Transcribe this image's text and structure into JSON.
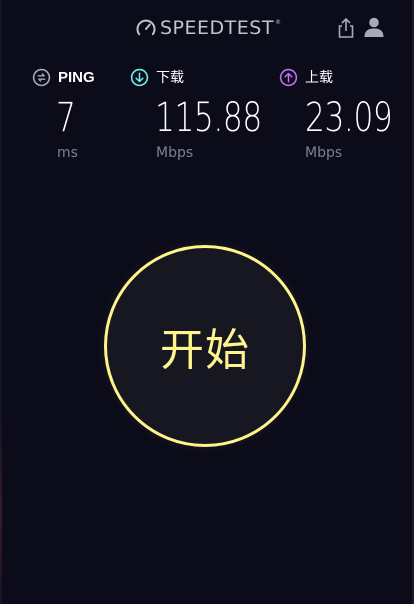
{
  "header": {
    "logo_text": "SPEEDTEST",
    "logo_reg": "®",
    "share_icon": "share-icon",
    "user_icon": "user-icon"
  },
  "metrics": {
    "ping": {
      "title": "PING",
      "value": "7",
      "unit": "ms",
      "icon": "ping-icon",
      "color": "#a7a7b8"
    },
    "download": {
      "title": "下载",
      "value": "115.88",
      "unit": "Mbps",
      "icon": "download-arrow-icon",
      "color": "#6ef0e6"
    },
    "upload": {
      "title": "上载",
      "value": "23.09",
      "unit": "Mbps",
      "icon": "upload-arrow-icon",
      "color": "#bf71f5"
    }
  },
  "go_button": {
    "label": "开始",
    "color": "#fff58c"
  }
}
